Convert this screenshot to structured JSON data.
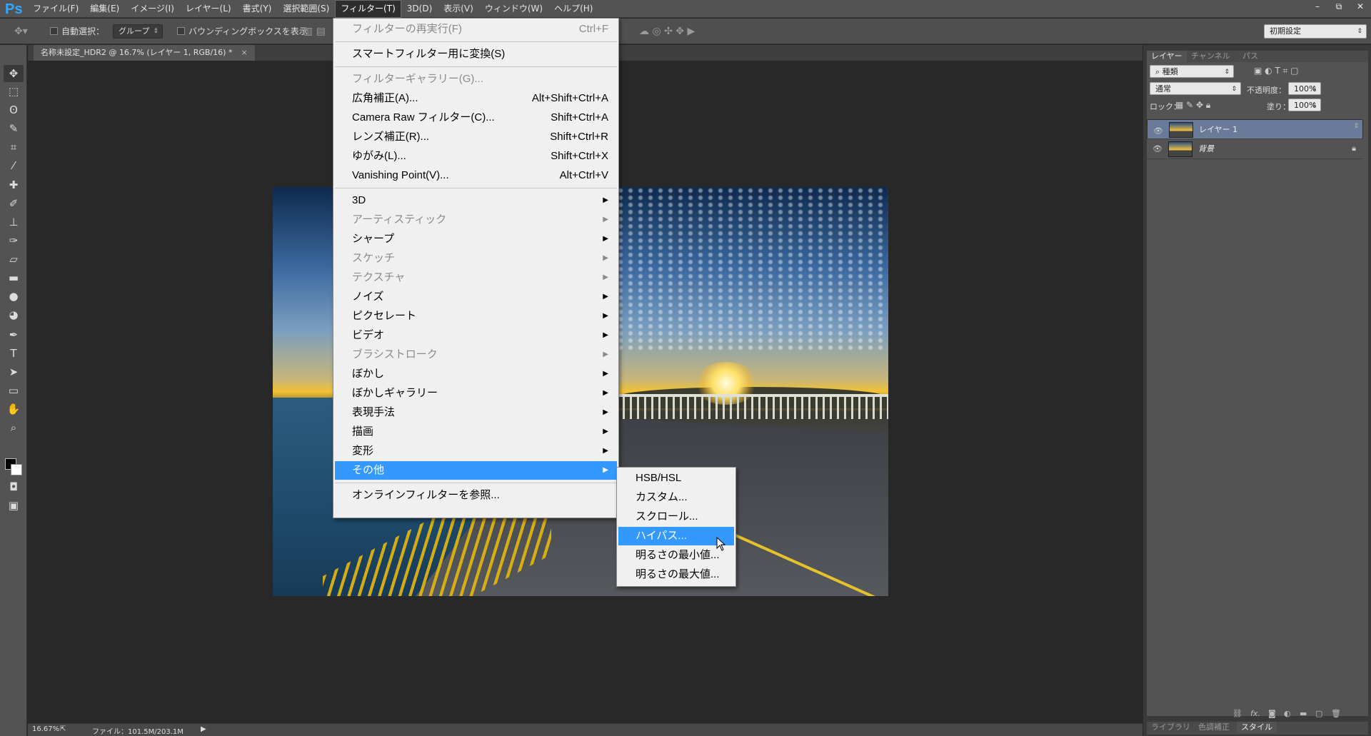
{
  "app": {
    "logo": "Ps"
  },
  "menubar": {
    "items": [
      "ファイル(F)",
      "編集(E)",
      "イメージ(I)",
      "レイヤー(L)",
      "書式(Y)",
      "選択範囲(S)",
      "フィルター(T)",
      "3D(D)",
      "表示(V)",
      "ウィンドウ(W)",
      "ヘルプ(H)"
    ],
    "active_index": 6
  },
  "window_controls": {
    "minimize": "–",
    "restore": "⧉",
    "close": "✕"
  },
  "options": {
    "auto_select_label": "自動選択：",
    "auto_select_value": "グループ",
    "bounding_box_label": "バウンディングボックスを表示",
    "workspace_value": "初期設定"
  },
  "document_tab": {
    "title": "名称未設定_HDR2 @ 16.7% (レイヤー 1, RGB/16) *",
    "close": "×"
  },
  "status": {
    "zoom": "16.67%",
    "file_info": "ファイル：101.5M/203.1M",
    "arrow": "▶"
  },
  "layers_panel": {
    "tabs": [
      "レイヤー",
      "チャンネル",
      "パス"
    ],
    "filter_label": "種類",
    "blend_mode": "通常",
    "opacity_label": "不透明度：",
    "opacity_value": "100%",
    "lock_label": "ロック：",
    "fill_label": "塗り：",
    "fill_value": "100%",
    "layers": [
      {
        "name": "レイヤー 1",
        "selected": true,
        "locked": false
      },
      {
        "name": "背景",
        "selected": false,
        "locked": true
      }
    ],
    "bottom_tabs": [
      "ライブラリ",
      "色調補正",
      "スタイル"
    ]
  },
  "filter_menu": {
    "items": [
      {
        "label": "フィルターの再実行(F)",
        "shortcut": "Ctrl+F",
        "disabled": true
      },
      {
        "separator": true
      },
      {
        "label": "スマートフィルター用に変換(S)",
        "shortcut": "",
        "disabled": false
      },
      {
        "separator": true
      },
      {
        "label": "フィルターギャラリー(G)...",
        "shortcut": "",
        "disabled": true
      },
      {
        "label": "広角補正(A)...",
        "shortcut": "Alt+Shift+Ctrl+A",
        "disabled": false
      },
      {
        "label": "Camera Raw フィルター(C)...",
        "shortcut": "Shift+Ctrl+A",
        "disabled": false
      },
      {
        "label": "レンズ補正(R)...",
        "shortcut": "Shift+Ctrl+R",
        "disabled": false
      },
      {
        "label": "ゆがみ(L)...",
        "shortcut": "Shift+Ctrl+X",
        "disabled": false
      },
      {
        "label": "Vanishing Point(V)...",
        "shortcut": "Alt+Ctrl+V",
        "disabled": false
      },
      {
        "separator": true
      },
      {
        "label": "3D",
        "submenu": true,
        "disabled": false
      },
      {
        "label": "アーティスティック",
        "submenu": true,
        "disabled": true
      },
      {
        "label": "シャープ",
        "submenu": true,
        "disabled": false
      },
      {
        "label": "スケッチ",
        "submenu": true,
        "disabled": true
      },
      {
        "label": "テクスチャ",
        "submenu": true,
        "disabled": true
      },
      {
        "label": "ノイズ",
        "submenu": true,
        "disabled": false
      },
      {
        "label": "ピクセレート",
        "submenu": true,
        "disabled": false
      },
      {
        "label": "ビデオ",
        "submenu": true,
        "disabled": false
      },
      {
        "label": "ブラシストローク",
        "submenu": true,
        "disabled": true
      },
      {
        "label": "ぼかし",
        "submenu": true,
        "disabled": false
      },
      {
        "label": "ぼかしギャラリー",
        "submenu": true,
        "disabled": false
      },
      {
        "label": "表現手法",
        "submenu": true,
        "disabled": false
      },
      {
        "label": "描画",
        "submenu": true,
        "disabled": false
      },
      {
        "label": "変形",
        "submenu": true,
        "disabled": false
      },
      {
        "label": "その他",
        "submenu": true,
        "disabled": false,
        "highlighted": true
      },
      {
        "separator": true
      },
      {
        "label": "オンラインフィルターを参照...",
        "shortcut": "",
        "disabled": false
      }
    ]
  },
  "other_submenu": {
    "items": [
      {
        "label": "HSB/HSL",
        "highlighted": false
      },
      {
        "label": "カスタム...",
        "highlighted": false
      },
      {
        "label": "スクロール...",
        "highlighted": false
      },
      {
        "label": "ハイパス...",
        "highlighted": true
      },
      {
        "label": "明るさの最小値...",
        "highlighted": false
      },
      {
        "label": "明るさの最大値...",
        "highlighted": false
      }
    ]
  },
  "colors": {
    "menu_highlight": "#3399ff",
    "ui_dark": "#535353",
    "layer_selected": "#6a7a99"
  }
}
